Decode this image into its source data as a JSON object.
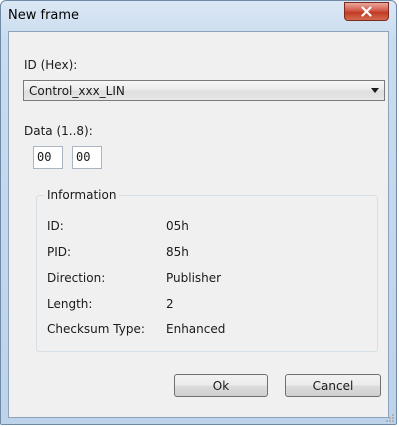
{
  "window": {
    "title": "New frame"
  },
  "id_field": {
    "label": "ID (Hex):",
    "selected": "Control_xxx_LIN"
  },
  "data_field": {
    "label": "Data (1..8):",
    "bytes": [
      "00",
      "00"
    ]
  },
  "information": {
    "title": "Information",
    "rows": [
      {
        "key": "ID:",
        "value": "05h"
      },
      {
        "key": "PID:",
        "value": "85h"
      },
      {
        "key": "Direction:",
        "value": "Publisher"
      },
      {
        "key": "Length:",
        "value": "2"
      },
      {
        "key": "Checksum Type:",
        "value": "Enhanced"
      }
    ]
  },
  "buttons": {
    "ok": "Ok",
    "cancel": "Cancel"
  },
  "icons": {
    "close": "close-icon",
    "dropdown": "chevron-down-icon",
    "grip": "resize-grip-icon"
  }
}
